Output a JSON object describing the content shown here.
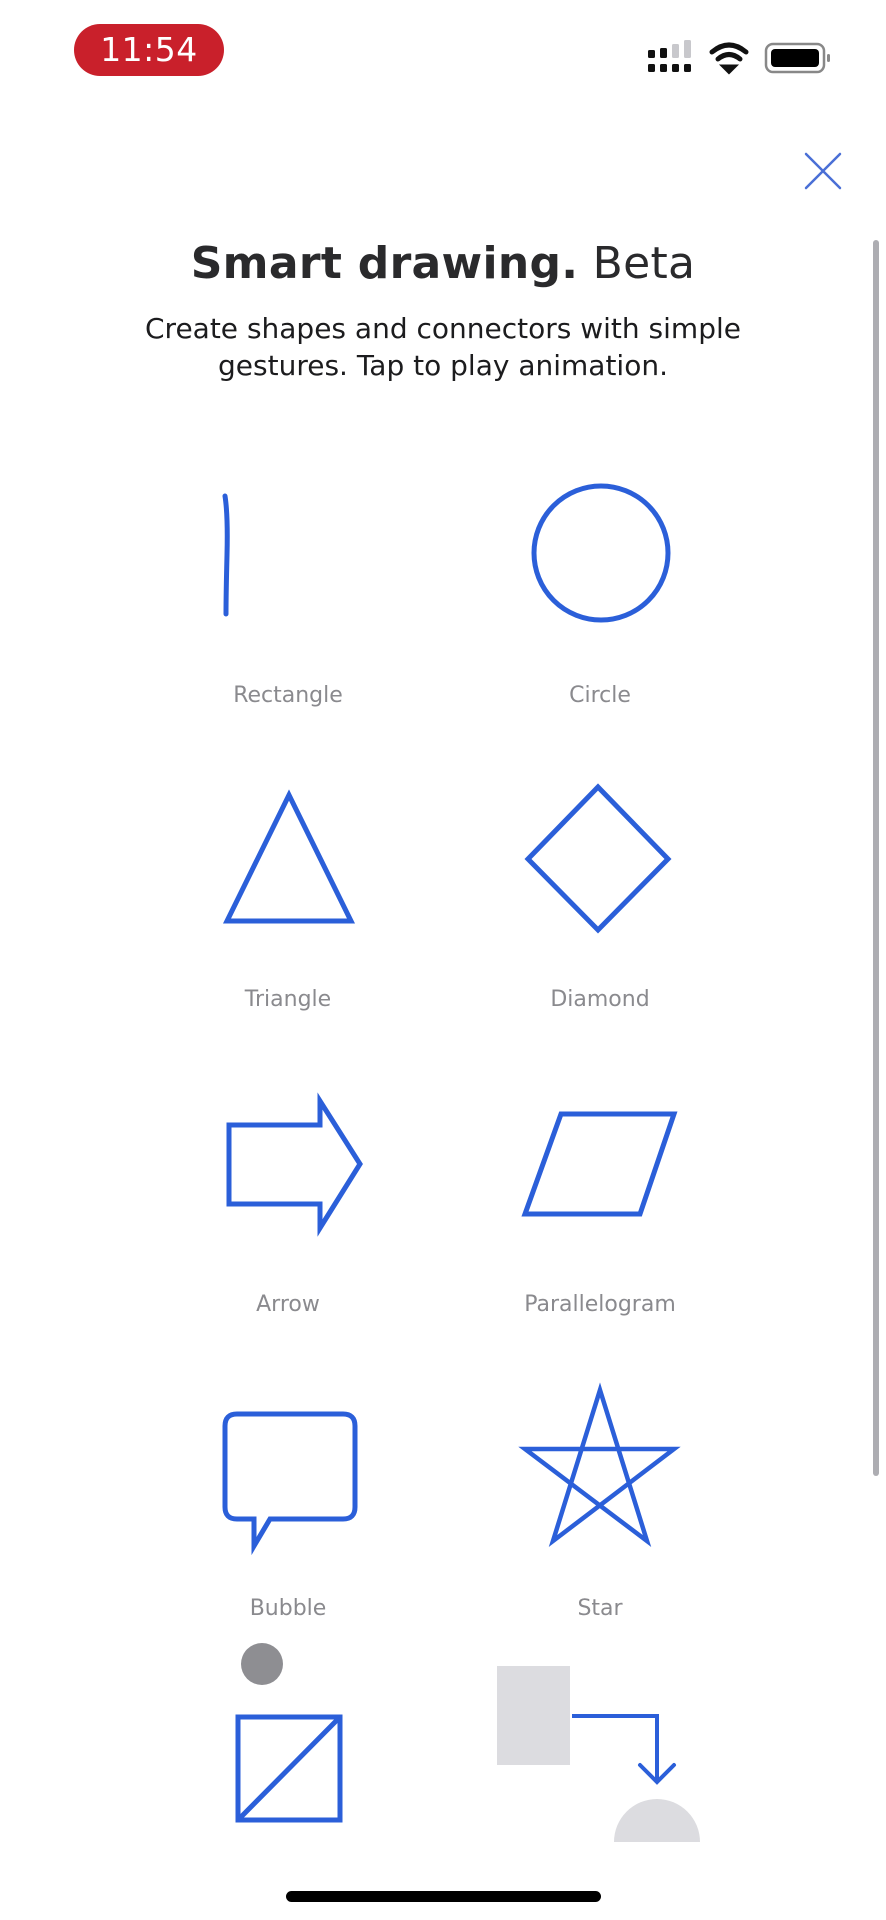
{
  "status_bar": {
    "time": "11:54",
    "time_pill_color": "#c9202b",
    "icons": [
      "cellular-signal-icon",
      "wifi-icon",
      "battery-icon"
    ]
  },
  "header": {
    "close_icon": "close-icon",
    "title_bold": "Smart drawing.",
    "title_light": "Beta",
    "subtitle_line1": "Create shapes and connectors with simple",
    "subtitle_line2": "gestures. Tap to play animation."
  },
  "theme": {
    "accent": "#2b5fd9",
    "label_color": "#8a8a8e",
    "placeholder_gray": "#dcdce0",
    "dot_gray": "#8e8e92"
  },
  "shapes": [
    {
      "label": "Rectangle",
      "icon": "rectangle-gesture-icon"
    },
    {
      "label": "Circle",
      "icon": "circle-icon"
    },
    {
      "label": "Triangle",
      "icon": "triangle-icon"
    },
    {
      "label": "Diamond",
      "icon": "diamond-icon"
    },
    {
      "label": "Arrow",
      "icon": "arrow-shape-icon"
    },
    {
      "label": "Parallelogram",
      "icon": "parallelogram-icon"
    },
    {
      "label": "Bubble",
      "icon": "speech-bubble-icon"
    },
    {
      "label": "Star",
      "icon": "star-icon"
    }
  ],
  "partial_row": [
    {
      "icon": "scribble-erase-icon"
    },
    {
      "icon": "connector-icon"
    }
  ]
}
